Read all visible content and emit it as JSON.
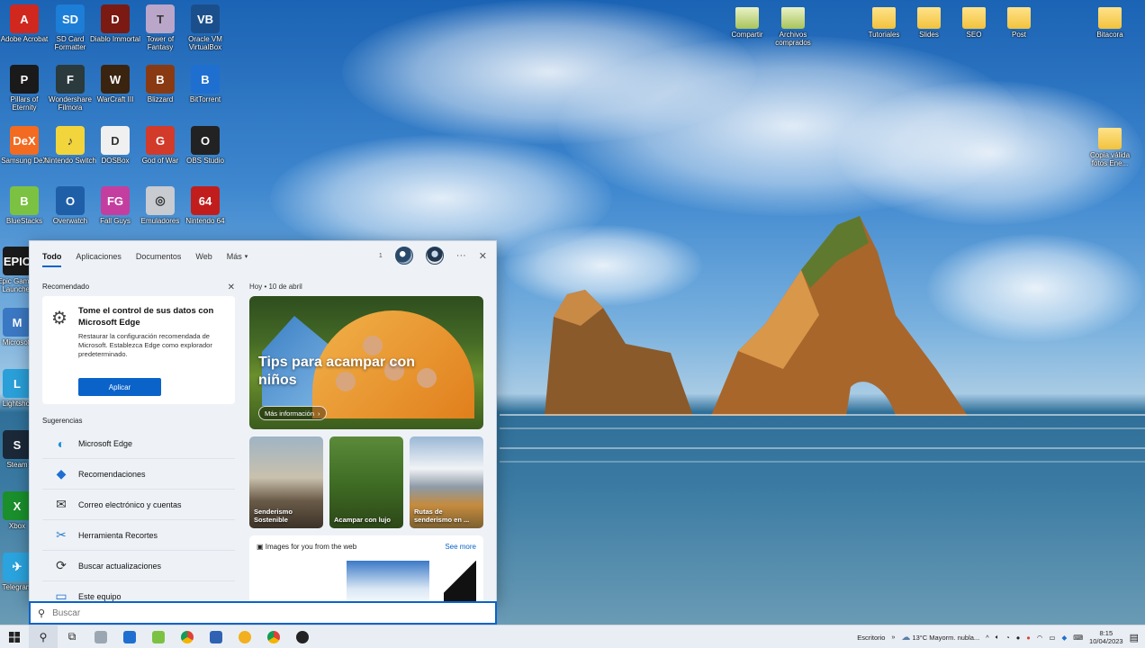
{
  "desktop": {
    "icons": [
      {
        "label": "Adobe Acrobat",
        "icon": "pdf-icon",
        "color": "#d0281f",
        "glyph": "A"
      },
      {
        "label": "SD Card Formatter",
        "icon": "sd-card-icon",
        "color": "#1c7ed6",
        "glyph": "SD"
      },
      {
        "label": "Diablo Immortal",
        "icon": "diablo-icon",
        "color": "#7a1a12",
        "glyph": "D"
      },
      {
        "label": "Tower of Fantasy",
        "icon": "game-icon",
        "color": "#b9a6c9",
        "glyph": "T"
      },
      {
        "label": "Oracle VM VirtualBox",
        "icon": "virtualbox-icon",
        "color": "#1b4f8c",
        "glyph": "VB"
      },
      {
        "label": "Pillars of Eternity",
        "icon": "game-icon",
        "color": "#1a1a1a",
        "glyph": "P"
      },
      {
        "label": "Wondershare Filmora",
        "icon": "filmora-icon",
        "color": "#2b3a3d",
        "glyph": "F"
      },
      {
        "label": "WarCraft III",
        "icon": "warcraft-icon",
        "color": "#3a2410",
        "glyph": "W"
      },
      {
        "label": "Blizzard",
        "icon": "game-icon",
        "color": "#8a3a12",
        "glyph": "B"
      },
      {
        "label": "BitTorrent",
        "icon": "bittorrent-icon",
        "color": "#1f6fd1",
        "glyph": "B"
      },
      {
        "label": "Samsung DeX",
        "icon": "dex-icon",
        "color": "#f26b21",
        "glyph": "DeX"
      },
      {
        "label": "Nintendo Switch",
        "icon": "music-icon",
        "color": "#f2d53c",
        "glyph": "♪"
      },
      {
        "label": "DOSBox",
        "icon": "dosbox-icon",
        "color": "#f0f0f0",
        "glyph": "D"
      },
      {
        "label": "God of War",
        "icon": "game-icon",
        "color": "#d23a2a",
        "glyph": "G"
      },
      {
        "label": "OBS Studio",
        "icon": "obs-icon",
        "color": "#222222",
        "glyph": "O"
      },
      {
        "label": "BlueStacks",
        "icon": "bluestacks-icon",
        "color": "#7cc242",
        "glyph": "B"
      },
      {
        "label": "Overwatch",
        "icon": "game-icon",
        "color": "#1f5fa8",
        "glyph": "O"
      },
      {
        "label": "Fall Guys",
        "icon": "game-icon",
        "color": "#c43ea0",
        "glyph": "FG"
      },
      {
        "label": "Emuladores",
        "icon": "disc-icon",
        "color": "#c8cbd0",
        "glyph": "◎"
      },
      {
        "label": "Nintendo 64",
        "icon": "n64-icon",
        "color": "#c21d1d",
        "glyph": "64"
      },
      {
        "label": "Epic Games Launcher",
        "icon": "epic-icon",
        "color": "#1a1a1a",
        "glyph": "EPIC"
      },
      {
        "label": "Microsoft",
        "icon": "app-icon",
        "color": "#3b78c3",
        "glyph": "M"
      },
      {
        "label": "Lightshot",
        "icon": "app-icon",
        "color": "#2a9fd8",
        "glyph": "L"
      },
      {
        "label": "Steam",
        "icon": "steam-icon",
        "color": "#1b2838",
        "glyph": "S"
      },
      {
        "label": "Xbox",
        "icon": "app-icon",
        "color": "#1a8f2c",
        "glyph": "X"
      },
      {
        "label": "Telegram",
        "icon": "telegram-icon",
        "color": "#2aa3de",
        "glyph": "✈"
      }
    ],
    "folders": [
      {
        "label": "Compartir",
        "green": true
      },
      {
        "label": "Archivos comprados",
        "green": true
      },
      {
        "label": "Tutoriales",
        "green": false
      },
      {
        "label": "Slides",
        "green": false
      },
      {
        "label": "SEO",
        "green": false
      },
      {
        "label": "Post",
        "green": false
      },
      {
        "label": "Bitacora",
        "green": false
      },
      {
        "label": "Copia válida fotos Ene...",
        "green": false
      }
    ]
  },
  "search_panel": {
    "tabs": [
      "Todo",
      "Aplicaciones",
      "Documentos",
      "Web",
      "Más"
    ],
    "tab_more_chevron": "▾",
    "badge_count": "1",
    "more_icon": "···",
    "close_icon": "✕",
    "recommended": {
      "title": "Recomendado",
      "card_title": "Tome el control de sus datos con Microsoft Edge",
      "card_body": "Restaurar la configuración recomendada de Microsoft. Establezca Edge como explorador predeterminado.",
      "button": "Aplicar"
    },
    "suggestions_title": "Sugerencias",
    "suggestions": [
      {
        "label": "Microsoft Edge",
        "icon": "edge-icon"
      },
      {
        "label": "Recomendaciones",
        "icon": "location-icon"
      },
      {
        "label": "Correo electrónico y cuentas",
        "icon": "mail-icon"
      },
      {
        "label": "Herramienta Recortes",
        "icon": "scissors-icon"
      },
      {
        "label": "Buscar actualizaciones",
        "icon": "refresh-icon"
      },
      {
        "label": "Este equipo",
        "icon": "computer-icon"
      }
    ],
    "date_label": "Hoy  •  10 de abril",
    "hero": {
      "title": "Tips para acampar con niños",
      "button": "Más información"
    },
    "thumbnails": [
      {
        "label": "Senderismo Sostenible"
      },
      {
        "label": "Acampar con lujo"
      },
      {
        "label": "Rutas de senderismo en ..."
      }
    ],
    "web_card": {
      "title": "Images for you from the web",
      "see_more": "See more"
    }
  },
  "search_box": {
    "placeholder": "Buscar"
  },
  "taskbar": {
    "desk_label": "Escritorio",
    "weather": "13°C  Mayorm. nubla...",
    "time": "8:15",
    "date": "10/04/2023"
  },
  "colors": {
    "accent": "#0a63c9"
  }
}
